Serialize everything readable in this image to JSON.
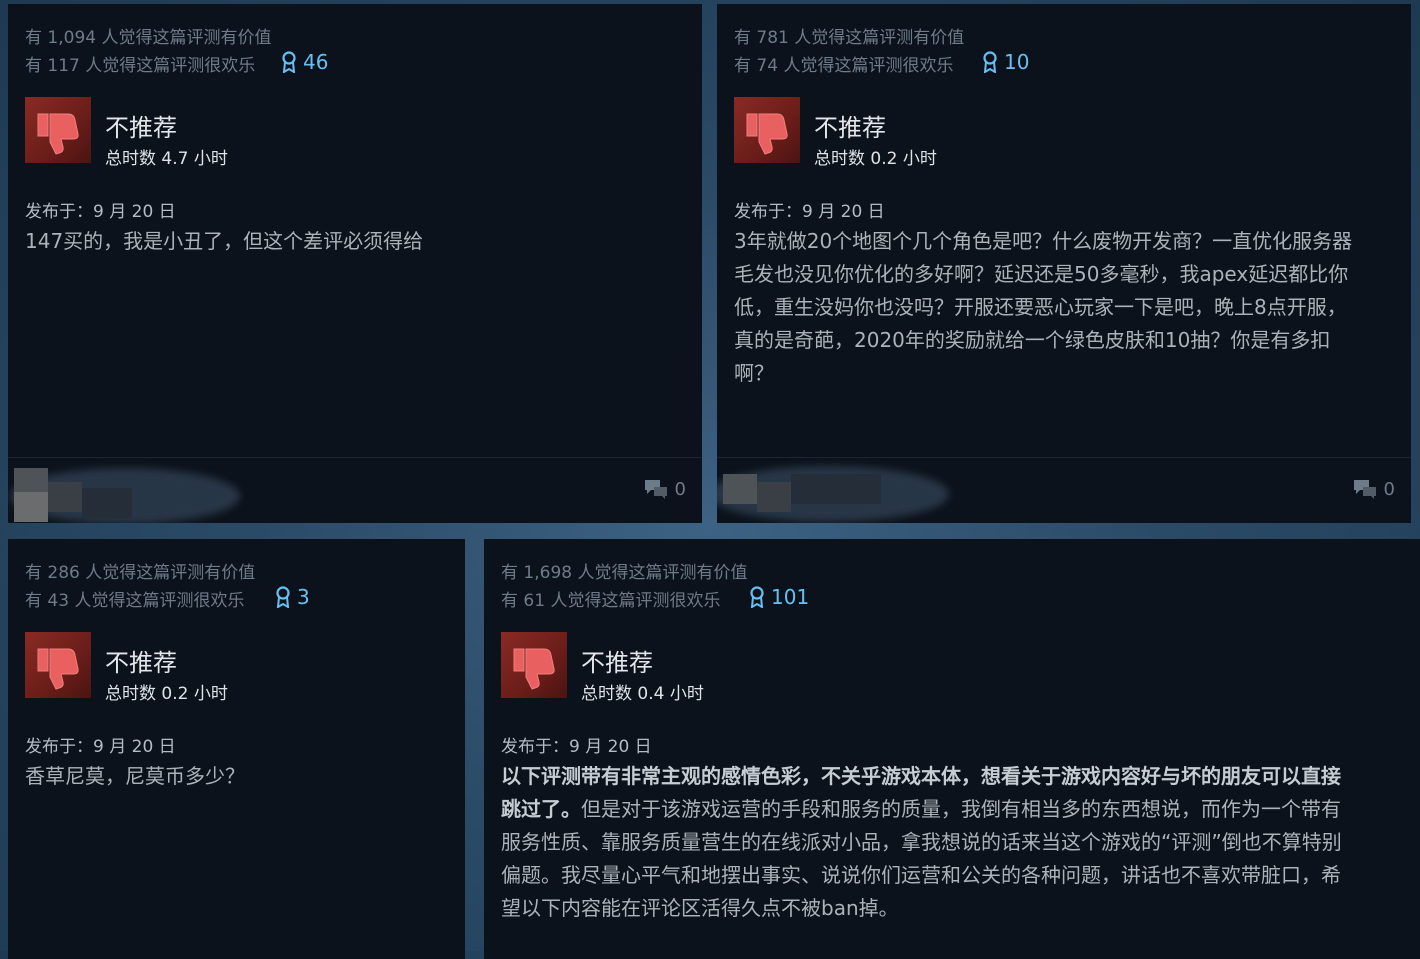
{
  "reviews": [
    {
      "helpful": "有 1,094 人觉得这篇评测有价值",
      "funny": "有 117 人觉得这篇评测很欢乐",
      "awards": "46",
      "verdict": "不推荐",
      "hours": "总时数 4.7 小时",
      "posted": "发布于：9 月 20 日",
      "content": "147买的，我是小丑了，但这个差评必须得给",
      "comments": "0"
    },
    {
      "helpful": "有 781 人觉得这篇评测有价值",
      "funny": "有 74 人觉得这篇评测很欢乐",
      "awards": "10",
      "verdict": "不推荐",
      "hours": "总时数 0.2 小时",
      "posted": "发布于：9 月 20 日",
      "content_lines": [
        "3年就做20个地图个几个角色是吧？什么废物开发商？一直优化服务器",
        "毛发也没见你优化的多好啊？延迟还是50多毫秒，我apex延迟都比你",
        "低，重生没妈你也没吗？开服还要恶心玩家一下是吧，晚上8点开服，",
        "真的是奇葩，2020年的奖励就给一个绿色皮肤和10抽？你是有多扣",
        "啊？"
      ],
      "comments": "0"
    },
    {
      "helpful": "有 286 人觉得这篇评测有价值",
      "funny": "有 43 人觉得这篇评测很欢乐",
      "awards": "3",
      "verdict": "不推荐",
      "hours": "总时数 0.2 小时",
      "posted": "发布于：9 月 20 日",
      "content": "香草尼莫，尼莫币多少？"
    },
    {
      "helpful": "有 1,698 人觉得这篇评测有价值",
      "funny": "有 61 人觉得这篇评测很欢乐",
      "awards": "101",
      "verdict": "不推荐",
      "hours": "总时数 0.4 小时",
      "posted": "发布于：9 月 20 日",
      "bold_line1": "以下评测带有非常主观的感情色彩，不关乎游戏本体，想看关于游戏内容好与坏的朋友可以直接",
      "bold_line2": "跳过了。",
      "rest_line2": "但是对于该游戏运营的手段和服务的质量，我倒有相当多的东西想说，而作为一个带有",
      "lines": [
        "服务性质、靠服务质量营生的在线派对小品，拿我想说的话来当这个游戏的“评测”倒也不算特别",
        "偏题。我尽量心平气和地摆出事实、说说你们运营和公关的各种问题，讲话也不喜欢带脏口，希",
        "望以下内容能在评论区活得久点不被ban掉。"
      ]
    }
  ],
  "colors": {
    "card_bg": "#0c121b",
    "award_blue": "#66c0f4",
    "thumb_red": "#8a2a24"
  },
  "icons": {
    "thumb": "thumbs-down-icon",
    "award": "award-ribbon-icon",
    "comment": "comment-bubble-icon"
  }
}
